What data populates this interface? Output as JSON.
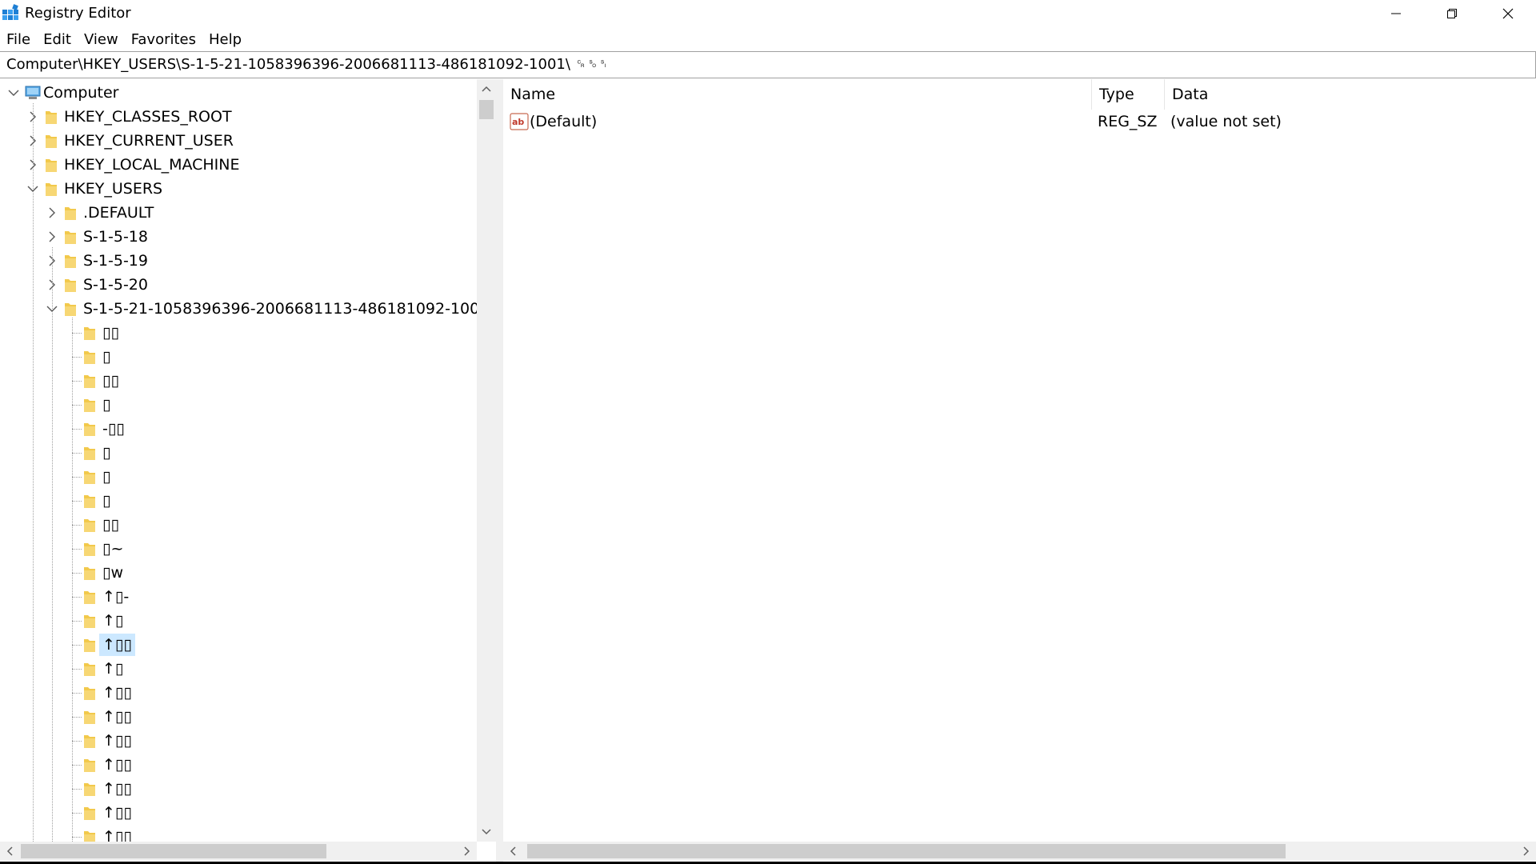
{
  "window": {
    "title": "Registry Editor",
    "controls": {
      "minimize": "minimize",
      "maximize": "restore",
      "close": "close"
    }
  },
  "menu": {
    "items": [
      "File",
      "Edit",
      "View",
      "Favorites",
      "Help"
    ]
  },
  "address": {
    "path": "Computer\\HKEY_USERS\\S-1-5-21-1058396396-2006681113-486181092-1001\\ ␍␎␏"
  },
  "tree": {
    "root_label": "Computer",
    "hives": [
      {
        "label": "HKEY_CLASSES_ROOT",
        "expanded": false
      },
      {
        "label": "HKEY_CURRENT_USER",
        "expanded": false
      },
      {
        "label": "HKEY_LOCAL_MACHINE",
        "expanded": false
      },
      {
        "label": "HKEY_USERS",
        "expanded": true
      }
    ],
    "users": [
      {
        "label": ".DEFAULT",
        "expanded": false
      },
      {
        "label": "S-1-5-18",
        "expanded": false
      },
      {
        "label": "S-1-5-19",
        "expanded": false
      },
      {
        "label": "S-1-5-20",
        "expanded": false
      },
      {
        "label": "S-1-5-21-1058396396-2006681113-486181092-1001",
        "expanded": true
      }
    ],
    "subkeys": [
      "",
      "",
      "",
      "",
      "-",
      " ",
      " ",
      " ",
      " ",
      " ~",
      " w",
      " -",
      " ",
      " ",
      " ",
      " ",
      " ",
      " ",
      " ",
      " ",
      " ",
      " "
    ],
    "subkeys_display": [
      "\u0000\u0000",
      "\u0000",
      "\u0000\u0000",
      "\u0000",
      "-\u0000\u0000",
      " \u0000",
      " \u0000",
      " \u0000",
      " \u0000\u0000",
      " \u0000~",
      " \u0000w",
      "↑\u0000-",
      "↑\u0000",
      "↑\u0000\u0000",
      "↑\u0000",
      "↑\u0000\u0000",
      "↑\u0000\u0000",
      "↑\u0000\u0000",
      "↑\u0000\u0000",
      "↑\u0000\u0000",
      "↑\u0000\u0000",
      "↑\u0000\u0000"
    ],
    "selected_index": 13
  },
  "list": {
    "columns": [
      "Name",
      "Type",
      "Data"
    ],
    "rows": [
      {
        "name": "(Default)",
        "type": "REG_SZ",
        "data": "(value not set)"
      }
    ]
  },
  "icons": {
    "app": "registry-editor-icon",
    "computer": "computer-icon",
    "folder": "folder-icon",
    "string_value": "string-value-icon"
  },
  "colors": {
    "selection": "#cce8ff",
    "folder": "#e8b84a",
    "scrollbar_track": "#f0f0f0",
    "scrollbar_thumb": "#cdcdcd"
  }
}
